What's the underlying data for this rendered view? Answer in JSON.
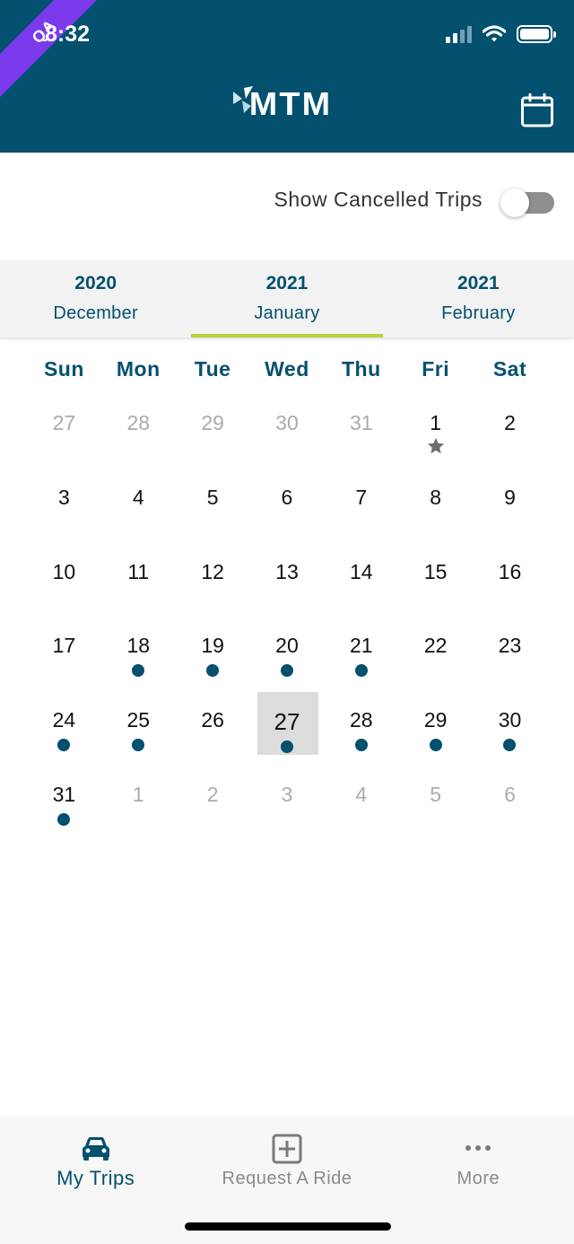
{
  "status_bar": {
    "time": "8:32",
    "badge": "QA"
  },
  "header": {
    "logo_text": "MTM"
  },
  "filters": {
    "show_cancelled_label": "Show Cancelled Trips",
    "show_cancelled_on": false
  },
  "month_tabs": [
    {
      "year": "2020",
      "month": "December",
      "active": false
    },
    {
      "year": "2021",
      "month": "January",
      "active": true
    },
    {
      "year": "2021",
      "month": "February",
      "active": false
    }
  ],
  "calendar": {
    "weekdays": [
      "Sun",
      "Mon",
      "Tue",
      "Wed",
      "Thu",
      "Fri",
      "Sat"
    ],
    "days": [
      {
        "n": "27",
        "muted": true
      },
      {
        "n": "28",
        "muted": true
      },
      {
        "n": "29",
        "muted": true
      },
      {
        "n": "30",
        "muted": true
      },
      {
        "n": "31",
        "muted": true
      },
      {
        "n": "1",
        "marker": "star"
      },
      {
        "n": "2"
      },
      {
        "n": "3"
      },
      {
        "n": "4"
      },
      {
        "n": "5"
      },
      {
        "n": "6"
      },
      {
        "n": "7"
      },
      {
        "n": "8"
      },
      {
        "n": "9"
      },
      {
        "n": "10"
      },
      {
        "n": "11"
      },
      {
        "n": "12"
      },
      {
        "n": "13"
      },
      {
        "n": "14"
      },
      {
        "n": "15"
      },
      {
        "n": "16"
      },
      {
        "n": "17"
      },
      {
        "n": "18",
        "marker": "dot"
      },
      {
        "n": "19",
        "marker": "dot"
      },
      {
        "n": "20",
        "marker": "dot"
      },
      {
        "n": "21",
        "marker": "dot"
      },
      {
        "n": "22"
      },
      {
        "n": "23"
      },
      {
        "n": "24",
        "marker": "dot"
      },
      {
        "n": "25",
        "marker": "dot"
      },
      {
        "n": "26"
      },
      {
        "n": "27",
        "marker": "dot",
        "selected": true
      },
      {
        "n": "28",
        "marker": "dot"
      },
      {
        "n": "29",
        "marker": "dot"
      },
      {
        "n": "30",
        "marker": "dot"
      },
      {
        "n": "31",
        "marker": "dot"
      },
      {
        "n": "1",
        "muted": true
      },
      {
        "n": "2",
        "muted": true
      },
      {
        "n": "3",
        "muted": true
      },
      {
        "n": "4",
        "muted": true
      },
      {
        "n": "5",
        "muted": true
      },
      {
        "n": "6",
        "muted": true
      }
    ]
  },
  "bottom_nav": [
    {
      "label": "My Trips",
      "icon": "car-icon",
      "active": true
    },
    {
      "label": "Request A Ride",
      "icon": "plus-square-icon",
      "active": false
    },
    {
      "label": "More",
      "icon": "more-dots-icon",
      "active": false
    }
  ],
  "colors": {
    "primary": "#03506F",
    "accent": "#B9CF3A",
    "badge": "#7C3AED",
    "muted_text": "#ABABAB"
  }
}
